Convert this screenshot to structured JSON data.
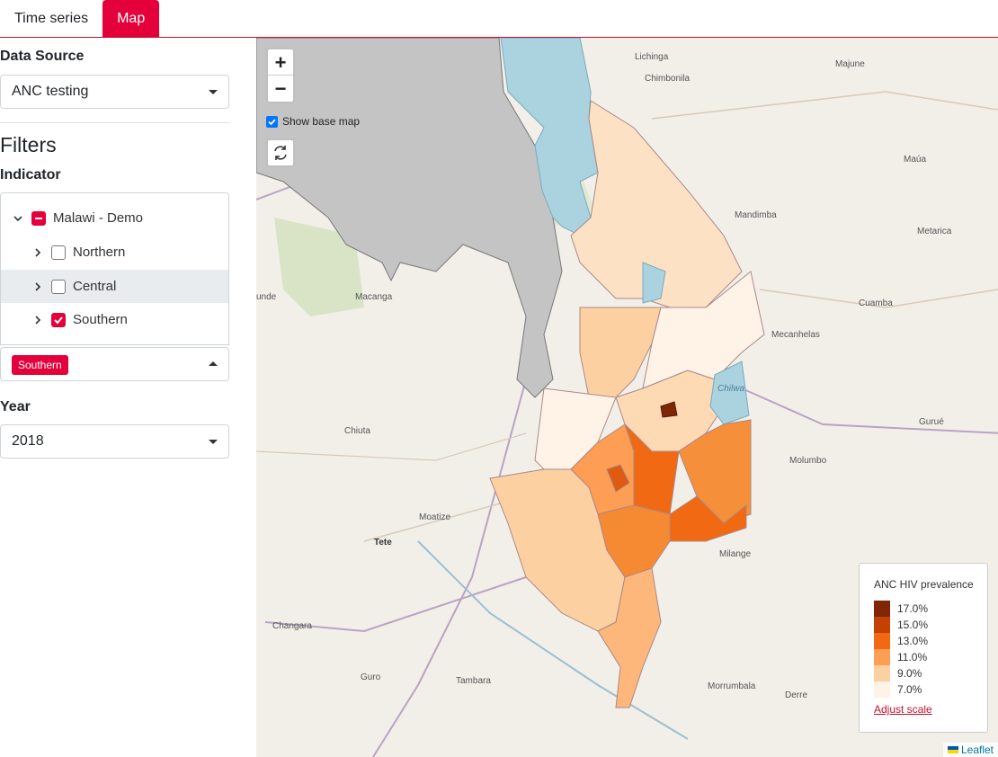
{
  "tabs": [
    {
      "label": "Time series",
      "active": false
    },
    {
      "label": "Map",
      "active": true
    }
  ],
  "sidebar": {
    "data_source_label": "Data Source",
    "data_source_value": "ANC testing",
    "filters_heading": "Filters",
    "indicator_label": "Indicator",
    "tree": {
      "root": {
        "label": "Malawi - Demo",
        "state": "indeterminate"
      },
      "children": [
        {
          "label": "Northern",
          "checked": false
        },
        {
          "label": "Central",
          "checked": false
        },
        {
          "label": "Southern",
          "checked": true
        }
      ]
    },
    "selected_chip": "Southern",
    "year_label": "Year",
    "year_value": "2018"
  },
  "map": {
    "show_base_map_label": "Show base map",
    "show_base_map_checked": true,
    "zoom_in": "+",
    "zoom_out": "−",
    "legend": {
      "title": "ANC HIV prevalence",
      "items": [
        {
          "label": "17.0%",
          "color": "#7f2704"
        },
        {
          "label": "15.0%",
          "color": "#c44103"
        },
        {
          "label": "13.0%",
          "color": "#f16913"
        },
        {
          "label": "11.0%",
          "color": "#fd9e54"
        },
        {
          "label": "9.0%",
          "color": "#fdd0a2"
        },
        {
          "label": "7.0%",
          "color": "#fff3e8"
        }
      ],
      "adjust_link": "Adjust scale"
    },
    "attribution": "Leaflet",
    "places": [
      "Lichinga",
      "Chimbonila",
      "Majune",
      "Maúa",
      "Mandimba",
      "Metarica",
      "Cuamba",
      "Mecanhelas",
      "Gurué",
      "Molumbo",
      "Milange",
      "Morrumbala",
      "Derre",
      "Macanga",
      "Chiuta",
      "Moatize",
      "Tete",
      "Changara",
      "Guro",
      "Tambara",
      "unde",
      "Chilwa"
    ]
  },
  "colors": {
    "accent": "#e4003b",
    "lake": "#aad3df",
    "other_regions": "#c8c8c8"
  }
}
